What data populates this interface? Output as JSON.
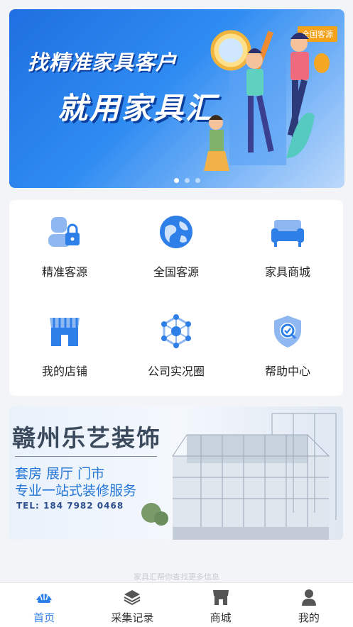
{
  "banner": {
    "slogan_line1": "找精准家具客户",
    "slogan_line2": "就用家具汇",
    "badge": "全国客源",
    "slide_count": 3,
    "active_slide": 1
  },
  "menu": {
    "items": [
      {
        "label": "精准客源",
        "icon": "person-lock-icon"
      },
      {
        "label": "全国客源",
        "icon": "globe-icon"
      },
      {
        "label": "家具商城",
        "icon": "sofa-icon"
      },
      {
        "label": "我的店铺",
        "icon": "shop-icon"
      },
      {
        "label": "公司实况圈",
        "icon": "network-hexagon-icon"
      },
      {
        "label": "帮助中心",
        "icon": "shield-check-icon"
      }
    ]
  },
  "ad": {
    "title": "赣州乐艺装饰",
    "line1": "套房 展厅 门市",
    "line2": "专业一站式装修服务",
    "tel": "TEL: 184 7982 0468"
  },
  "footer_note": "家具汇帮你查找更多信息",
  "tabbar": {
    "tabs": [
      {
        "label": "首页",
        "icon": "home-shell-icon"
      },
      {
        "label": "采集记录",
        "icon": "layers-icon"
      },
      {
        "label": "商城",
        "icon": "store-icon"
      },
      {
        "label": "我的",
        "icon": "user-icon"
      }
    ],
    "active_index": 0
  },
  "colors": {
    "primary": "#2f7fe8",
    "banner_dark": "#1f6fe0",
    "badge": "#f4a21a"
  }
}
